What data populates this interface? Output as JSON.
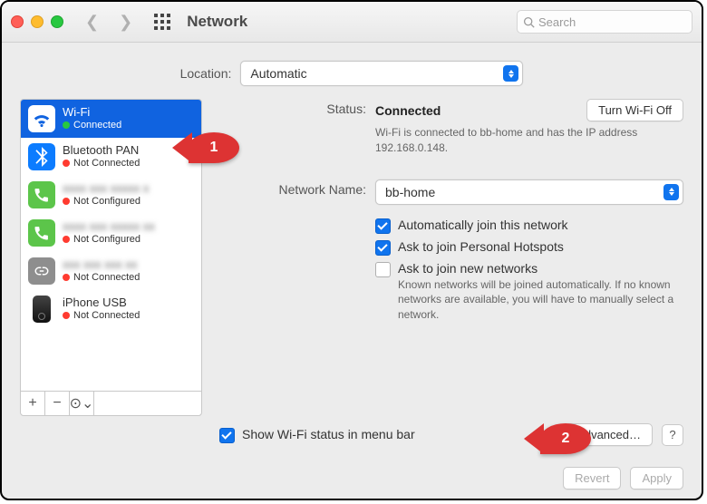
{
  "titlebar": {
    "title": "Network",
    "search_placeholder": "Search"
  },
  "location": {
    "label": "Location:",
    "value": "Automatic"
  },
  "sidebar": {
    "items": [
      {
        "name": "Wi-Fi",
        "status": "Connected",
        "dot": "green",
        "selected": true,
        "icon_type": "wifi"
      },
      {
        "name": "Bluetooth PAN",
        "status": "Not Connected",
        "dot": "red",
        "selected": false,
        "icon_type": "bluetooth"
      },
      {
        "name": "(hidden)",
        "status": "Not Configured",
        "dot": "red",
        "selected": false,
        "icon_type": "phone-green"
      },
      {
        "name": "(hidden)",
        "status": "Not Configured",
        "dot": "red",
        "selected": false,
        "icon_type": "phone-green"
      },
      {
        "name": "(hidden)",
        "status": "Not Connected",
        "dot": "red",
        "selected": false,
        "icon_type": "link-grey"
      },
      {
        "name": "iPhone USB",
        "status": "Not Connected",
        "dot": "red",
        "selected": false,
        "icon_type": "iphone"
      }
    ],
    "footer": {
      "add": "+",
      "remove": "−",
      "menu": "⊙⌄"
    }
  },
  "detail": {
    "status_label": "Status:",
    "status_value": "Connected",
    "turn_off_btn": "Turn Wi-Fi Off",
    "status_hint": "Wi-Fi is connected to bb-home and has the IP address 192.168.0.148.",
    "network_name_label": "Network Name:",
    "network_name_value": "bb-home",
    "opts": {
      "auto_join": "Automatically join this network",
      "ask_hotspot": "Ask to join Personal Hotspots",
      "ask_new": "Ask to join new networks",
      "ask_new_hint": "Known networks will be joined automatically. If no known networks are available, you will have to manually select a network."
    },
    "show_status": "Show Wi-Fi status in menu bar",
    "advanced_btn": "Advanced…",
    "help": "?"
  },
  "footer_buttons": {
    "revert": "Revert",
    "apply": "Apply"
  },
  "annotations": {
    "pin1": "1",
    "pin2": "2"
  }
}
